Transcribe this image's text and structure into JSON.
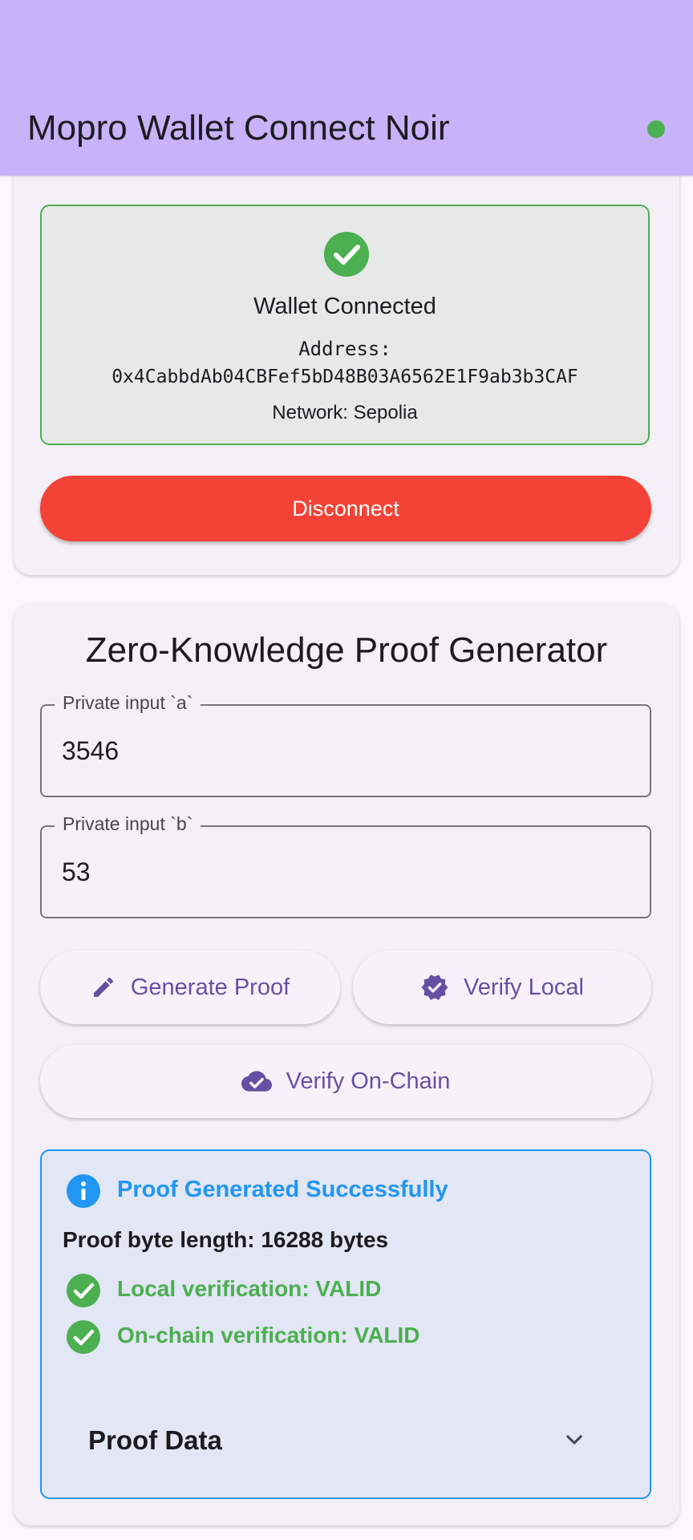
{
  "appbar": {
    "title": "Mopro Wallet Connect Noir",
    "status_dot_color": "#4caf50"
  },
  "wallet": {
    "status": "Wallet Connected",
    "address_label": "Address:",
    "address": "0x4CabbdAb04CBFef5bD48B03A6562E1F9ab3b3CAF",
    "network": "Network: Sepolia",
    "disconnect_label": "Disconnect",
    "status_icon": "check-circle-icon"
  },
  "zk": {
    "title": "Zero-Knowledge Proof Generator",
    "input_a": {
      "label": "Private input `a`",
      "value": "3546"
    },
    "input_b": {
      "label": "Private input `b`",
      "value": "53"
    },
    "buttons": {
      "generate": {
        "label": "Generate Proof",
        "icon": "pencil-icon"
      },
      "verify_local": {
        "label": "Verify Local",
        "icon": "verified-badge-icon"
      },
      "verify_chain": {
        "label": "Verify On-Chain",
        "icon": "cloud-check-icon"
      }
    }
  },
  "result": {
    "title": "Proof Generated Successfully",
    "byte_length": "Proof byte length: 16288 bytes",
    "local_verification": "Local verification: VALID",
    "onchain_verification": "On-chain verification: VALID",
    "proof_data_label": "Proof Data"
  },
  "colors": {
    "appbar": "#c8b3fa",
    "success": "#4caf50",
    "danger": "#f44336",
    "info": "#2196f3",
    "primary": "#6750a4"
  }
}
